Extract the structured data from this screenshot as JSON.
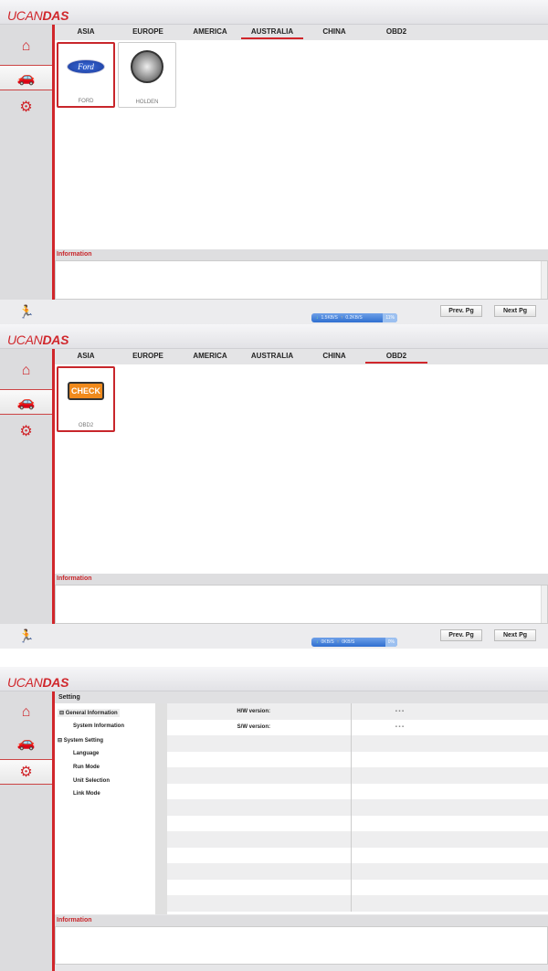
{
  "app": {
    "logo_light": "UCAN",
    "logo_bold": "DAS"
  },
  "tabs": [
    "ASIA",
    "EUROPE",
    "AMERICA",
    "AUSTRALIA",
    "CHINA",
    "OBD2"
  ],
  "screen1": {
    "active_tab": "AUSTRALIA",
    "cards": [
      {
        "label": "FORD",
        "logo": "Ford"
      },
      {
        "label": "HOLDEN"
      }
    ],
    "info_label": "Information",
    "download": "1.5KB/S",
    "upload": "0.2KB/S",
    "progress": "11%",
    "prev": "Prev. Pg",
    "next": "Next Pg"
  },
  "screen2": {
    "active_tab": "OBD2",
    "cards": [
      {
        "label": "OBD2",
        "logo": "CHECK"
      }
    ],
    "info_label": "Information",
    "download": "0KB/S",
    "upload": "0KB/S",
    "progress": "0%",
    "prev": "Prev. Pg",
    "next": "Next Pg"
  },
  "screen3": {
    "header": "Setting",
    "tree": [
      "General Information",
      "System Information",
      "System Setting",
      "Language",
      "Run Mode",
      "Unit Selection",
      "Link Mode"
    ],
    "rows": [
      {
        "key": "H/W version:",
        "value": "- - -"
      },
      {
        "key": "S/W version:",
        "value": "- - -"
      }
    ],
    "info_label": "Information"
  },
  "colors": {
    "accent": "#d0262b",
    "speed_bar": "#2f6fd0"
  }
}
